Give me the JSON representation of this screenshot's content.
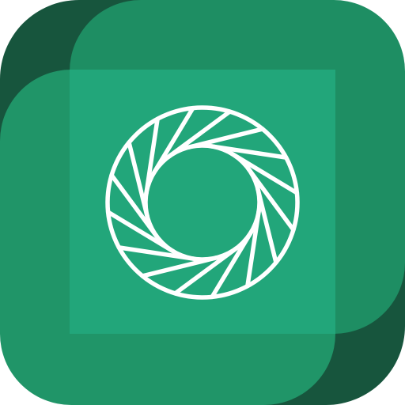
{
  "app_icon": {
    "name": "aperture-icon",
    "colors": {
      "shadow_dark": "#17553d",
      "tile_back": "#1e8e63",
      "tile_front": "#209568",
      "panel_center": "#22a67a",
      "glyph": "#ffffff"
    }
  }
}
